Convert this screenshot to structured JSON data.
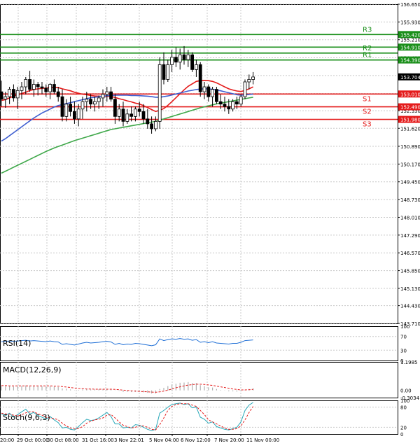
{
  "chart_data": {
    "type": "candlestick",
    "instrument_timeframe": "",
    "x_ticks": [
      "20:00",
      "29 Oct 00:00",
      "30 Oct 08:00",
      "31 Oct 16:00",
      "3 Nov 22:01",
      "5 Nov 04:00",
      "6 Nov 12:00",
      "7 Nov 20:00",
      "11 Nov 00:00"
    ],
    "y_ticks": [
      "156.650",
      "155.930",
      "155.210",
      "154.480",
      "153.760",
      "153.030",
      "152.330",
      "151.620",
      "150.890",
      "150.170",
      "149.450",
      "148.730",
      "148.010",
      "147.290",
      "146.570",
      "145.850",
      "145.130",
      "144.430",
      "143.710"
    ],
    "ylim": [
      143.71,
      156.65
    ],
    "current_price": {
      "label": "153.704",
      "value": 153.704
    },
    "levels": [
      {
        "name": "R3",
        "label": "155.420",
        "value": 155.42,
        "color": "#1a8f1a"
      },
      {
        "name": "",
        "label": "154.910",
        "value": 154.91,
        "color": "#1a8f1a"
      },
      {
        "name": "R2",
        "label": "",
        "value": 154.67,
        "color": "#1a8f1a"
      },
      {
        "name": "R1",
        "label": "154.390",
        "value": 154.39,
        "color": "#1a8f1a"
      },
      {
        "name": "S1",
        "label": "153.010",
        "value": 153.01,
        "color": "#e41b1b"
      },
      {
        "name": "S2",
        "label": "152.490",
        "value": 152.49,
        "color": "#e41b1b"
      },
      {
        "name": "S3",
        "label": "151.980",
        "value": 151.98,
        "color": "#e41b1b"
      }
    ],
    "candles": [
      {
        "o": 153.1,
        "h": 153.55,
        "l": 152.5,
        "c": 152.8
      },
      {
        "o": 152.8,
        "h": 153.1,
        "l": 152.45,
        "c": 152.9
      },
      {
        "o": 152.9,
        "h": 153.3,
        "l": 152.6,
        "c": 153.2
      },
      {
        "o": 153.2,
        "h": 153.4,
        "l": 152.7,
        "c": 152.85
      },
      {
        "o": 152.85,
        "h": 153.3,
        "l": 152.4,
        "c": 153.15
      },
      {
        "o": 153.15,
        "h": 153.5,
        "l": 152.8,
        "c": 153.3
      },
      {
        "o": 153.3,
        "h": 153.7,
        "l": 153.0,
        "c": 153.6
      },
      {
        "o": 153.6,
        "h": 153.95,
        "l": 153.1,
        "c": 153.2
      },
      {
        "o": 153.2,
        "h": 153.6,
        "l": 152.9,
        "c": 153.4
      },
      {
        "o": 153.4,
        "h": 153.5,
        "l": 152.95,
        "c": 153.3
      },
      {
        "o": 153.3,
        "h": 153.5,
        "l": 153.0,
        "c": 153.25
      },
      {
        "o": 153.25,
        "h": 153.4,
        "l": 152.9,
        "c": 153.1
      },
      {
        "o": 153.1,
        "h": 153.45,
        "l": 152.8,
        "c": 153.4
      },
      {
        "o": 153.4,
        "h": 153.6,
        "l": 153.0,
        "c": 153.1
      },
      {
        "o": 153.1,
        "h": 153.3,
        "l": 152.7,
        "c": 152.9
      },
      {
        "o": 152.9,
        "h": 153.2,
        "l": 151.9,
        "c": 152.1
      },
      {
        "o": 152.1,
        "h": 152.8,
        "l": 151.9,
        "c": 152.6
      },
      {
        "o": 152.6,
        "h": 152.9,
        "l": 152.1,
        "c": 152.3
      },
      {
        "o": 152.3,
        "h": 152.7,
        "l": 151.8,
        "c": 152.0
      },
      {
        "o": 152.0,
        "h": 152.6,
        "l": 151.7,
        "c": 152.4
      },
      {
        "o": 152.4,
        "h": 152.9,
        "l": 152.0,
        "c": 152.7
      },
      {
        "o": 152.7,
        "h": 153.1,
        "l": 152.3,
        "c": 152.8
      },
      {
        "o": 152.8,
        "h": 153.0,
        "l": 152.4,
        "c": 152.6
      },
      {
        "o": 152.6,
        "h": 152.9,
        "l": 152.3,
        "c": 152.7
      },
      {
        "o": 152.7,
        "h": 152.95,
        "l": 152.4,
        "c": 152.85
      },
      {
        "o": 152.85,
        "h": 153.2,
        "l": 152.5,
        "c": 153.0
      },
      {
        "o": 153.0,
        "h": 153.3,
        "l": 152.7,
        "c": 153.1
      },
      {
        "o": 153.1,
        "h": 153.3,
        "l": 152.7,
        "c": 152.8
      },
      {
        "o": 152.8,
        "h": 153.0,
        "l": 151.8,
        "c": 152.1
      },
      {
        "o": 152.1,
        "h": 152.6,
        "l": 151.9,
        "c": 152.4
      },
      {
        "o": 152.4,
        "h": 152.7,
        "l": 151.7,
        "c": 151.9
      },
      {
        "o": 151.9,
        "h": 152.4,
        "l": 151.8,
        "c": 152.2
      },
      {
        "o": 152.2,
        "h": 152.5,
        "l": 151.9,
        "c": 152.1
      },
      {
        "o": 152.1,
        "h": 152.5,
        "l": 151.9,
        "c": 152.4
      },
      {
        "o": 152.4,
        "h": 152.7,
        "l": 152.1,
        "c": 152.3
      },
      {
        "o": 152.3,
        "h": 152.6,
        "l": 151.8,
        "c": 152.0
      },
      {
        "o": 152.0,
        "h": 152.4,
        "l": 151.6,
        "c": 151.8
      },
      {
        "o": 151.8,
        "h": 152.1,
        "l": 151.4,
        "c": 151.6
      },
      {
        "o": 151.6,
        "h": 152.1,
        "l": 151.5,
        "c": 151.9
      },
      {
        "o": 151.9,
        "h": 154.5,
        "l": 151.6,
        "c": 154.2
      },
      {
        "o": 154.2,
        "h": 154.7,
        "l": 153.4,
        "c": 153.6
      },
      {
        "o": 153.6,
        "h": 154.4,
        "l": 153.5,
        "c": 154.2
      },
      {
        "o": 154.2,
        "h": 154.8,
        "l": 153.9,
        "c": 154.5
      },
      {
        "o": 154.5,
        "h": 154.9,
        "l": 154.1,
        "c": 154.3
      },
      {
        "o": 154.3,
        "h": 154.85,
        "l": 154.0,
        "c": 154.6
      },
      {
        "o": 154.6,
        "h": 154.95,
        "l": 154.2,
        "c": 154.4
      },
      {
        "o": 154.4,
        "h": 154.8,
        "l": 154.1,
        "c": 154.6
      },
      {
        "o": 154.6,
        "h": 154.7,
        "l": 153.9,
        "c": 154.0
      },
      {
        "o": 154.0,
        "h": 154.4,
        "l": 153.7,
        "c": 154.2
      },
      {
        "o": 154.2,
        "h": 154.3,
        "l": 152.9,
        "c": 153.1
      },
      {
        "o": 153.1,
        "h": 153.5,
        "l": 152.8,
        "c": 153.3
      },
      {
        "o": 153.3,
        "h": 153.4,
        "l": 152.7,
        "c": 152.9
      },
      {
        "o": 152.9,
        "h": 153.3,
        "l": 152.5,
        "c": 153.2
      },
      {
        "o": 153.2,
        "h": 153.3,
        "l": 152.6,
        "c": 152.7
      },
      {
        "o": 152.7,
        "h": 153.0,
        "l": 152.4,
        "c": 152.6
      },
      {
        "o": 152.6,
        "h": 152.9,
        "l": 152.3,
        "c": 152.5
      },
      {
        "o": 152.5,
        "h": 152.8,
        "l": 152.2,
        "c": 152.4
      },
      {
        "o": 152.4,
        "h": 152.8,
        "l": 152.3,
        "c": 152.7
      },
      {
        "o": 152.7,
        "h": 152.9,
        "l": 152.4,
        "c": 152.6
      },
      {
        "o": 152.6,
        "h": 153.0,
        "l": 152.5,
        "c": 152.9
      },
      {
        "o": 152.9,
        "h": 153.6,
        "l": 152.8,
        "c": 153.5
      },
      {
        "o": 153.5,
        "h": 153.8,
        "l": 153.2,
        "c": 153.6
      },
      {
        "o": 153.6,
        "h": 153.9,
        "l": 153.4,
        "c": 153.7
      }
    ],
    "moving_averages": [
      {
        "color": "#e41b1b",
        "y": [
          152.75,
          152.78,
          152.85,
          152.92,
          152.98,
          153.03,
          153.08,
          153.15,
          153.19,
          153.22,
          153.24,
          153.25,
          153.27,
          153.28,
          153.27,
          153.22,
          153.18,
          153.14,
          153.08,
          153.04,
          153.0,
          152.98,
          152.95,
          152.93,
          152.92,
          152.91,
          152.92,
          152.91,
          152.87,
          152.82,
          152.78,
          152.73,
          152.69,
          152.64,
          152.6,
          152.54,
          152.46,
          152.38,
          152.3,
          152.35,
          152.42,
          152.55,
          152.7,
          152.86,
          153.02,
          153.18,
          153.32,
          153.42,
          153.52,
          153.55,
          153.56,
          153.55,
          153.52,
          153.46,
          153.38,
          153.3,
          153.22,
          153.17,
          153.13,
          153.11,
          153.15,
          153.22,
          153.3
        ]
      },
      {
        "color": "#3f5fd0",
        "y": [
          151.1,
          151.2,
          151.32,
          151.44,
          151.56,
          151.68,
          151.8,
          151.92,
          152.04,
          152.14,
          152.24,
          152.32,
          152.4,
          152.48,
          152.54,
          152.58,
          152.62,
          152.66,
          152.7,
          152.74,
          152.78,
          152.82,
          152.86,
          152.88,
          152.9,
          152.92,
          152.94,
          152.95,
          152.96,
          152.96,
          152.96,
          152.96,
          152.95,
          152.95,
          152.94,
          152.93,
          152.92,
          152.9,
          152.88,
          152.88,
          152.9,
          152.93,
          152.97,
          153.01,
          153.05,
          153.09,
          153.13,
          153.16,
          153.19,
          153.21,
          153.22,
          153.22,
          153.2,
          153.17,
          153.14,
          153.1,
          153.06,
          153.02,
          152.98,
          152.96,
          152.97,
          152.99,
          153.01
        ]
      },
      {
        "color": "#3fa84a",
        "y": [
          149.8,
          149.88,
          149.96,
          150.04,
          150.12,
          150.2,
          150.28,
          150.36,
          150.44,
          150.52,
          150.6,
          150.68,
          150.75,
          150.82,
          150.88,
          150.94,
          151.0,
          151.06,
          151.12,
          151.17,
          151.22,
          151.27,
          151.32,
          151.37,
          151.42,
          151.47,
          151.52,
          151.57,
          151.6,
          151.63,
          151.66,
          151.69,
          151.72,
          151.75,
          151.78,
          151.81,
          151.84,
          151.87,
          151.9,
          151.95,
          152.0,
          152.05,
          152.1,
          152.15,
          152.2,
          152.25,
          152.3,
          152.35,
          152.4,
          152.45,
          152.49,
          152.53,
          152.57,
          152.61,
          152.64,
          152.67,
          152.7,
          152.73,
          152.76,
          152.79,
          152.82,
          152.85,
          152.88
        ]
      }
    ],
    "indicators": {
      "rsi": {
        "label": "RSI(14)",
        "ticks": [
          "100",
          "70",
          "30",
          "0"
        ],
        "ylim": [
          0,
          100
        ],
        "values": [
          55,
          56,
          57,
          56,
          57,
          58,
          59,
          57,
          58,
          57,
          56,
          55,
          57,
          55,
          54,
          47,
          49,
          47,
          45,
          48,
          51,
          53,
          51,
          52,
          53,
          55,
          56,
          54,
          47,
          50,
          46,
          48,
          47,
          50,
          49,
          47,
          45,
          43,
          46,
          63,
          58,
          61,
          63,
          62,
          64,
          62,
          63,
          59,
          61,
          53,
          55,
          52,
          55,
          51,
          50,
          49,
          48,
          50,
          50,
          53,
          58,
          59,
          60
        ]
      },
      "macd": {
        "label": "MACD(12,26,9)",
        "ticks": [
          "1.1985",
          "0.00",
          "-0.3034"
        ],
        "ylim": [
          -0.3034,
          1.1985
        ],
        "hist": [
          0.18,
          0.17,
          0.18,
          0.16,
          0.17,
          0.19,
          0.21,
          0.18,
          0.19,
          0.19,
          0.18,
          0.17,
          0.18,
          0.16,
          0.14,
          0.08,
          0.07,
          0.04,
          0.01,
          0.02,
          0.04,
          0.05,
          0.04,
          0.04,
          0.05,
          0.06,
          0.07,
          0.05,
          -0.01,
          -0.02,
          -0.06,
          -0.06,
          -0.07,
          -0.06,
          -0.06,
          -0.08,
          -0.1,
          -0.13,
          -0.13,
          0.06,
          0.11,
          0.18,
          0.25,
          0.28,
          0.32,
          0.33,
          0.35,
          0.31,
          0.31,
          0.22,
          0.18,
          0.13,
          0.12,
          0.06,
          0.02,
          -0.01,
          -0.04,
          -0.04,
          -0.05,
          -0.04,
          0.02,
          0.06,
          0.09
        ],
        "signal": [
          0.2,
          0.2,
          0.19,
          0.19,
          0.19,
          0.19,
          0.19,
          0.19,
          0.19,
          0.19,
          0.19,
          0.19,
          0.19,
          0.18,
          0.18,
          0.16,
          0.14,
          0.12,
          0.1,
          0.08,
          0.07,
          0.06,
          0.06,
          0.05,
          0.05,
          0.05,
          0.05,
          0.05,
          0.04,
          0.03,
          0.01,
          0.0,
          -0.02,
          -0.03,
          -0.04,
          -0.05,
          -0.06,
          -0.07,
          -0.08,
          -0.06,
          -0.03,
          0.01,
          0.06,
          0.11,
          0.15,
          0.19,
          0.22,
          0.24,
          0.26,
          0.26,
          0.25,
          0.23,
          0.21,
          0.18,
          0.15,
          0.12,
          0.09,
          0.06,
          0.04,
          0.02,
          0.02,
          0.03,
          0.04
        ]
      },
      "stoch": {
        "label": "Stoch(9,6,3)",
        "ticks": [
          "100",
          "80",
          "20",
          "0"
        ],
        "ylim": [
          0,
          100
        ],
        "k": [
          60,
          55,
          62,
          50,
          58,
          66,
          74,
          60,
          64,
          55,
          50,
          44,
          52,
          42,
          34,
          18,
          20,
          14,
          12,
          22,
          34,
          44,
          40,
          42,
          48,
          56,
          64,
          52,
          30,
          30,
          18,
          20,
          18,
          28,
          26,
          20,
          14,
          10,
          14,
          62,
          70,
          80,
          88,
          90,
          92,
          88,
          90,
          78,
          80,
          50,
          44,
          32,
          36,
          22,
          18,
          14,
          12,
          16,
          20,
          36,
          70,
          86,
          94
        ],
        "d": [
          62,
          60,
          59,
          56,
          54,
          57,
          63,
          66,
          66,
          60,
          56,
          50,
          48,
          46,
          42,
          32,
          24,
          18,
          15,
          16,
          22,
          32,
          38,
          42,
          44,
          48,
          56,
          58,
          48,
          36,
          26,
          22,
          18,
          20,
          24,
          24,
          20,
          14,
          12,
          28,
          48,
          70,
          82,
          88,
          90,
          90,
          90,
          86,
          82,
          70,
          58,
          42,
          36,
          30,
          24,
          18,
          14,
          14,
          16,
          24,
          42,
          64,
          82
        ]
      }
    }
  }
}
